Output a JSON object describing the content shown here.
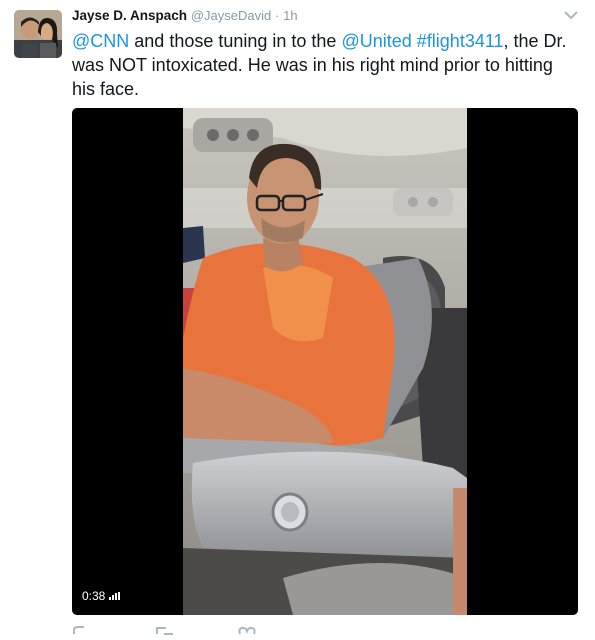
{
  "author": {
    "name": "Jayse D. Anspach",
    "handle": "@JayseDavid",
    "separator": "·",
    "time": "1h"
  },
  "tweet": {
    "mention_1": "@CNN",
    "text_1": " and those tuning in to the ",
    "mention_2": "@United",
    "hashtag": "#flight3411",
    "text_2": ", the Dr. was NOT intoxicated. He was in his right mind prior to hitting his face."
  },
  "media": {
    "duration": "0:38"
  },
  "icons": {
    "more": "chevron-down-icon",
    "reply": "reply-icon",
    "retweet": "retweet-icon",
    "like": "like-icon"
  },
  "colors": {
    "link": "#1b95e0",
    "muted": "#8899a6",
    "shirt": "#e8733c"
  }
}
